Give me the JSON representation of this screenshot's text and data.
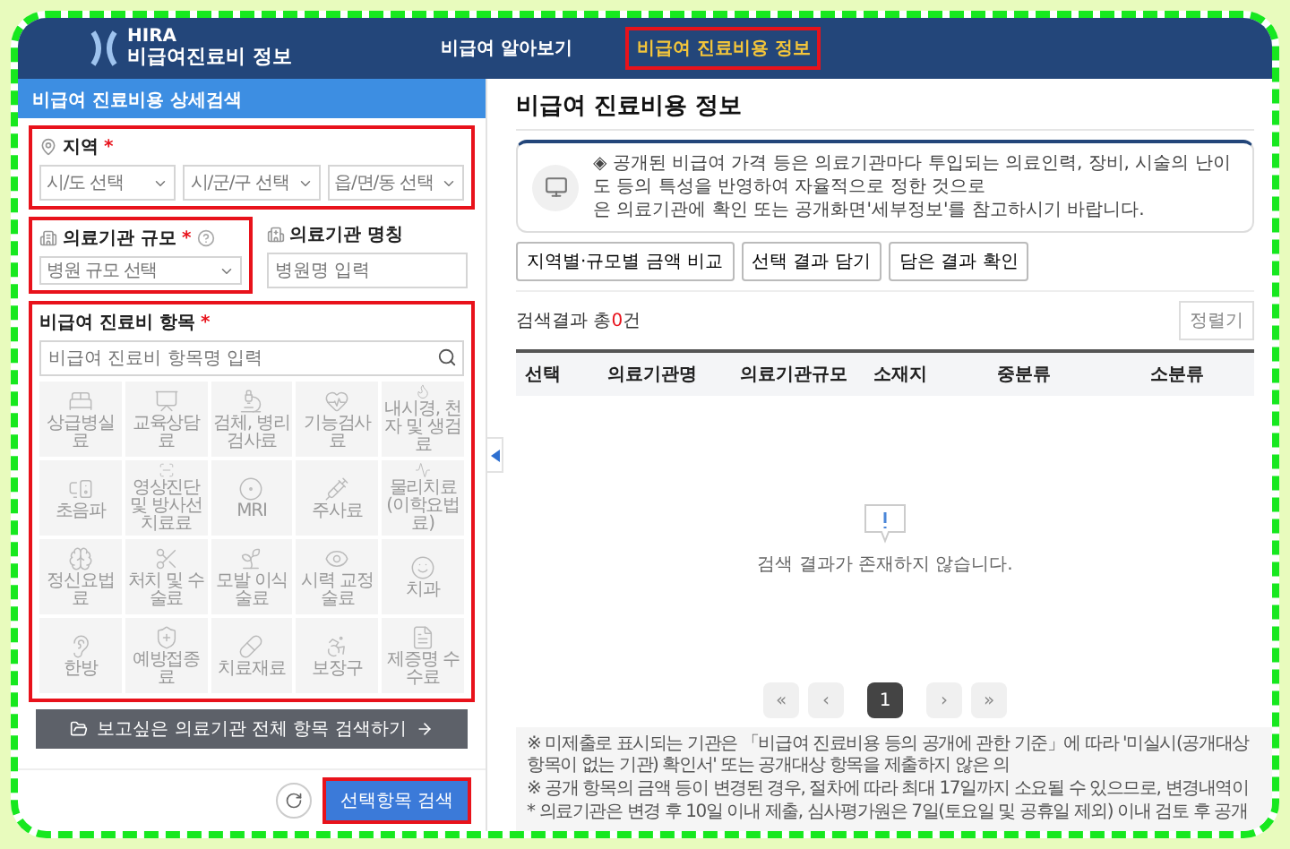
{
  "header": {
    "logo_top": "HIRA",
    "logo_bottom": "비급여진료비 정보",
    "tabs": [
      {
        "label": "비급여 알아보기",
        "selected": false
      },
      {
        "label": "비급여 진료비용 정보",
        "selected": true
      }
    ]
  },
  "sidebar": {
    "title": "비급여 진료비용 상세검색",
    "region": {
      "label": "지역",
      "mark": "*",
      "selects": [
        "시/도 선택",
        "시/군/구 선택",
        "읍/면/동 선택"
      ]
    },
    "scale": {
      "label": "의료기관 규모",
      "mark": "*",
      "select": "병원 규모 선택"
    },
    "name": {
      "label": "의료기관 명칭",
      "placeholder": "병원명 입력"
    },
    "items": {
      "label": "비급여 진료비 항목",
      "mark": "*",
      "placeholder": "비급여 진료비 항목명 입력",
      "categories": [
        "상급병실료",
        "교육상담료",
        "검체, 병리 검사료",
        "기능검사료",
        "내시경, 천자 및 생검료",
        "초음파",
        "영상진단 및 방사선치료료",
        "MRI",
        "주사료",
        "물리치료 (이학요법료)",
        "정신요법료",
        "처치 및 수술료",
        "모발 이식술료",
        "시력 교정술료",
        "치과",
        "한방",
        "예방접종료",
        "치료재료",
        "보장구",
        "제증명 수수료"
      ]
    },
    "all_items_button": "보고싶은 의료기관 전체 항목 검색하기",
    "search_button": "선택항목 검색"
  },
  "main": {
    "title": "비급여 진료비용 정보",
    "notice": [
      "◈ 공개된 비급여 가격 등은 의료기관마다 투입되는 의료인력, 장비, 시술의 난이도 등의 특성을 반영하여 자율적으로 정한 것으로",
      "은 의료기관에 확인 또는 공개화면'세부정보'를 참고하시기 바랍니다."
    ],
    "actions": [
      "지역별·규모별 금액 비교",
      "선택 결과 담기",
      "담은 결과 확인"
    ],
    "result": {
      "prefix": "검색결과 총",
      "count": "0",
      "suffix": "건"
    },
    "sort": "정렬기",
    "columns": [
      "선택",
      "의료기관명",
      "의료기관규모",
      "소재지",
      "중분류",
      "소분류"
    ],
    "empty_message": "검색 결과가 존재하지 않습니다.",
    "pagination": [
      {
        "label": "«",
        "kind": "first"
      },
      {
        "label": "‹",
        "kind": "prev"
      },
      {
        "label": "1",
        "kind": "page",
        "selected": true
      },
      {
        "label": "›",
        "kind": "next"
      },
      {
        "label": "»",
        "kind": "last"
      }
    ],
    "footnotes": [
      "※ 미제출로 표시되는 기관은 「비급여 진료비용 등의 공개에 관한 기준」에 따라 '미실시(공개대상 항목이 없는 기관) 확인서' 또는 공개대상 항목을 제출하지 않은 의",
      "※ 공개 항목의 금액 등이 변경된 경우, 절차에 따라 최대 17일까지 소요될 수 있으므로, 변경내역이",
      "* 의료기관은 변경 후 10일 이내 제출, 심사평가원은 7일(토요일 및 공휴일 제외) 이내 검토 후 공개"
    ]
  }
}
